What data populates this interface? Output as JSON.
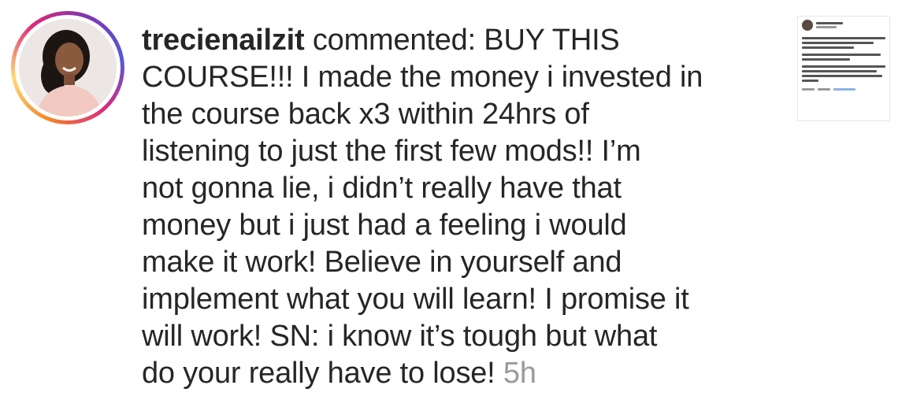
{
  "comment": {
    "username": "trecienailzit",
    "lines": [
      " commented: BUY THIS",
      "COURSE!!! I made the money i invested in",
      "the course back x3 within 24hrs of",
      "listening to just the first few mods!! I’m",
      "not gonna lie, i didn’t really have that",
      "money but i just had a feeling i would",
      "make it work! Believe in yourself and",
      "implement what you will learn! I promise it",
      "will work! SN: i know it’s tough but what",
      "do your really have to lose! "
    ],
    "timestamp": "5h"
  },
  "colors": {
    "text": "#262626",
    "timestamp": "#9a9a9a",
    "ring_start": "#f58529",
    "ring_mid": "#dd2a7b",
    "ring_end": "#515bd4"
  },
  "icons": {
    "avatar": "profile-photo",
    "thumbnail": "tweet-screenshot-thumbnail"
  }
}
